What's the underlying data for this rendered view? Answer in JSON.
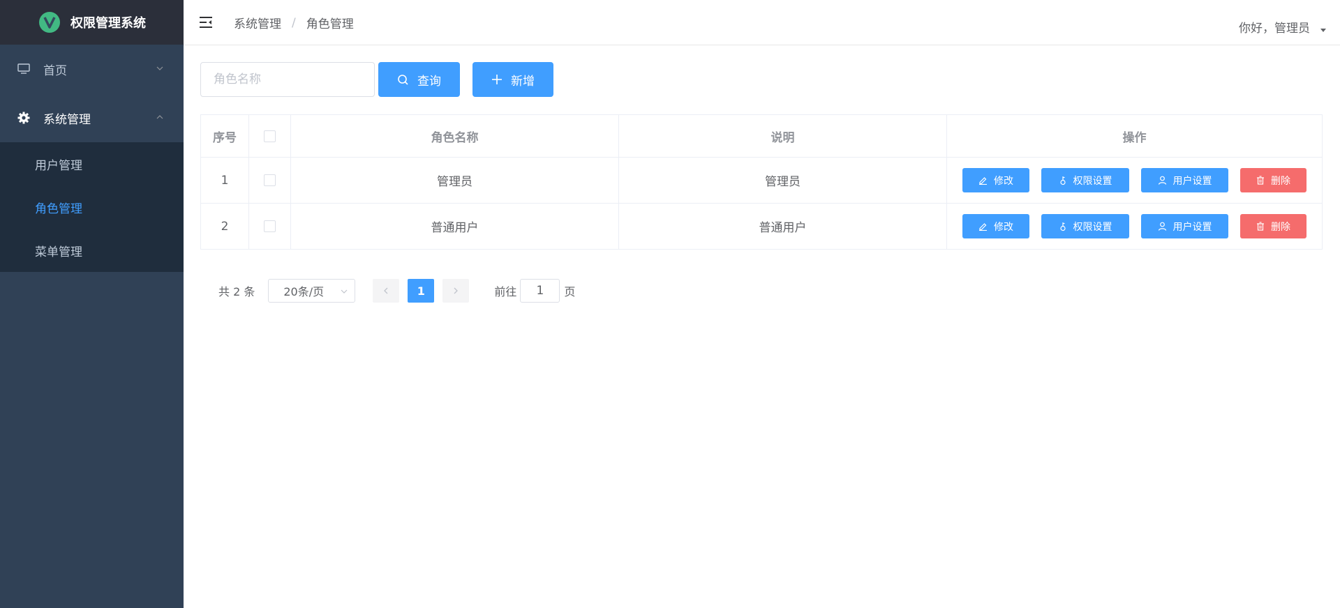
{
  "app": {
    "title": "权限管理系统",
    "logo_icon": "vue-logo-icon"
  },
  "colors": {
    "primary": "#409eff",
    "danger": "#f56c6c",
    "sidebar": "#304156",
    "sidebar_header": "#2b2f3a",
    "submenu": "#1f2d3d"
  },
  "sidebar": {
    "items": [
      {
        "label": "首页",
        "icon": "monitor-icon",
        "expanded": false
      },
      {
        "label": "系统管理",
        "icon": "gear-icon",
        "expanded": true
      }
    ],
    "subitems": [
      {
        "label": "用户管理",
        "active": false
      },
      {
        "label": "角色管理",
        "active": true
      },
      {
        "label": "菜单管理",
        "active": false
      }
    ]
  },
  "header": {
    "breadcrumb": [
      "系统管理",
      "角色管理"
    ],
    "breadcrumb_separator": "/",
    "user_greeting": "你好，管理员"
  },
  "toolbar": {
    "search_placeholder": "角色名称",
    "search_value": "",
    "query_label": "查询",
    "add_label": "新增"
  },
  "table": {
    "columns": {
      "index": "序号",
      "name": "角色名称",
      "desc": "说明",
      "ops": "操作"
    },
    "rows": [
      {
        "index": "1",
        "name": "管理员",
        "desc": "管理员"
      },
      {
        "index": "2",
        "name": "普通用户",
        "desc": "普通用户"
      }
    ],
    "actions": {
      "edit": "修改",
      "perm": "权限设置",
      "user": "用户设置",
      "delete": "删除"
    }
  },
  "pagination": {
    "total_text": "共 2 条",
    "page_size": "20条/页",
    "current_page": "1",
    "jump_label": "前往",
    "jump_value": "1",
    "jump_suffix": "页"
  }
}
